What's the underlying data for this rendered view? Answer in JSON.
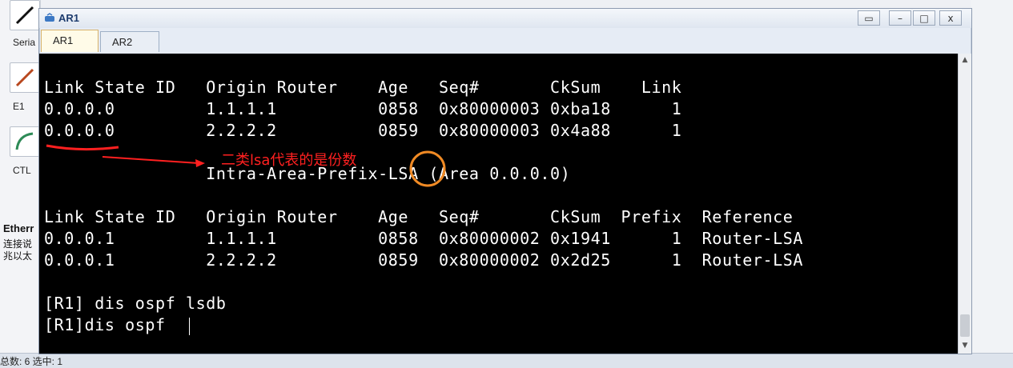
{
  "background": {
    "palette": [
      {
        "label": "Seria",
        "icon": "serial-cable-icon"
      },
      {
        "label": "E1",
        "icon": "e1-cable-icon"
      },
      {
        "label": "CTL",
        "icon": "ctl-cable-icon"
      }
    ],
    "ether_title": "Etherr",
    "ether_desc_1": "连接说",
    "ether_desc_2": "兆以太",
    "status": "总数: 6 选中: 1"
  },
  "window": {
    "title": "AR1",
    "tabs": [
      {
        "label": "AR1"
      },
      {
        "label": "AR2"
      }
    ],
    "restore": "▭",
    "minimize": "–",
    "maximize": "□",
    "close": "x"
  },
  "terminal": {
    "header1": "Link State ID   Origin Router    Age   Seq#       CkSum    Link",
    "row1": "0.0.0.0         1.1.1.1          0858  0x80000003 0xba18      1",
    "row2": "0.0.0.0         2.2.2.2          0859  0x80000003 0x4a88      1",
    "section": "                Intra-Area-Prefix-LSA (Area 0.0.0.0)",
    "header2": "Link State ID   Origin Router    Age   Seq#       CkSum  Prefix  Reference",
    "row3": "0.0.0.1         1.1.1.1          0858  0x80000002 0x1941      1  Router-LSA",
    "row4": "0.0.0.1         2.2.2.2          0859  0x80000002 0x2d25      1  Router-LSA",
    "cmd1": "[R1] dis ospf lsdb",
    "cmd2": "[R1]dis ospf "
  },
  "annotation": {
    "text": "二类lsa代表的是份数",
    "color": "#ff2020",
    "circle_color": "#f08a24"
  }
}
